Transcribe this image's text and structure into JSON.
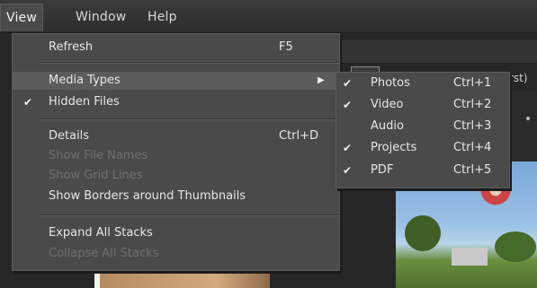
{
  "menubar": {
    "items": [
      "View",
      "Window",
      "Help"
    ]
  },
  "background": {
    "partial_text": "rst)"
  },
  "view_menu": {
    "items": [
      {
        "label": "Refresh",
        "shortcut": "F5"
      },
      {
        "label": "Media Types",
        "submenu": true
      },
      {
        "label": "Hidden Files",
        "checked": true
      },
      {
        "label": "Details",
        "shortcut": "Ctrl+D"
      },
      {
        "label": "Show File Names",
        "disabled": true
      },
      {
        "label": "Show Grid Lines",
        "disabled": true
      },
      {
        "label": "Show Borders around Thumbnails"
      },
      {
        "label": "Expand All Stacks"
      },
      {
        "label": "Collapse All Stacks",
        "disabled": true
      }
    ]
  },
  "media_submenu": {
    "items": [
      {
        "label": "Photos",
        "shortcut": "Ctrl+1",
        "checked": true
      },
      {
        "label": "Video",
        "shortcut": "Ctrl+2",
        "checked": true
      },
      {
        "label": "Audio",
        "shortcut": "Ctrl+3",
        "checked": false
      },
      {
        "label": "Projects",
        "shortcut": "Ctrl+4",
        "checked": true
      },
      {
        "label": "PDF",
        "shortcut": "Ctrl+5",
        "checked": true
      }
    ]
  },
  "icons": {
    "check": "checkmark-icon",
    "submenu_arrow": "triangle-right-icon"
  }
}
